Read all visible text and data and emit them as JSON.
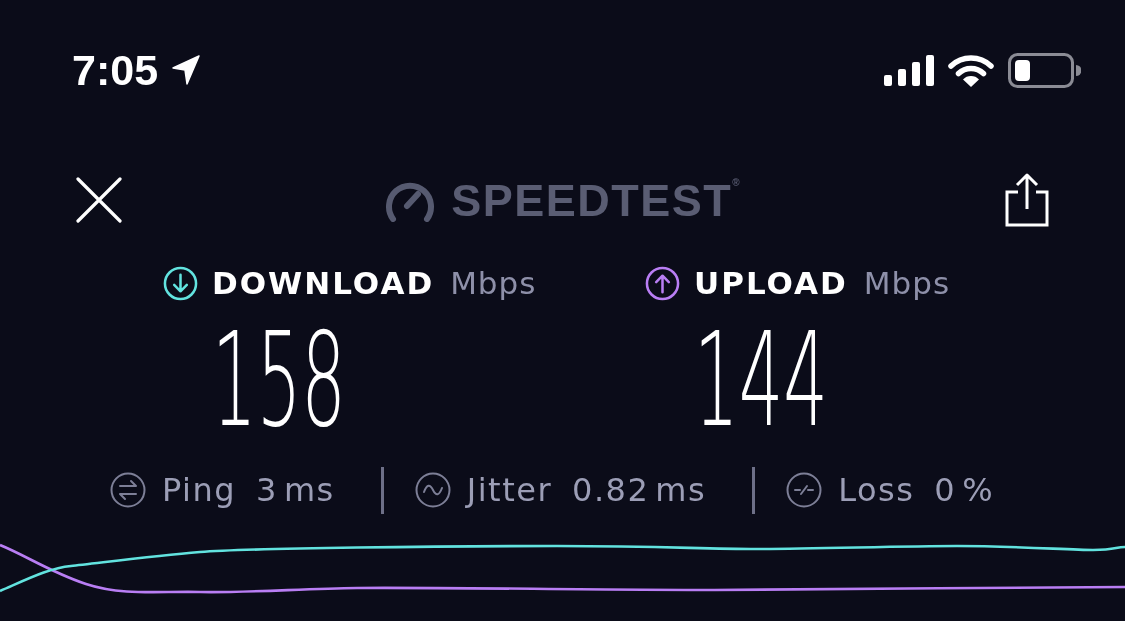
{
  "status_bar": {
    "time": "7:05"
  },
  "header": {
    "logo": "SPEEDTEST$^{®}$"
  },
  "results": [
    {
      "kind": "download",
      "label": "DOWNLOAD",
      "unit": "Mbps",
      "value": "158",
      "color": "#62e3df"
    },
    {
      "kind": "upload",
      "label": "UPLOAD",
      "unit": "Mbps",
      "value": "144",
      "color": "#b97ef4"
    }
  ],
  "metrics": [
    {
      "kind": "ping",
      "label": "Ping",
      "value": "3",
      "unit": "ms"
    },
    {
      "kind": "jitter",
      "label": "Jitter",
      "value": "0.82",
      "unit": "ms"
    },
    {
      "kind": "loss",
      "label": "Loss",
      "value": "0",
      "unit": "%"
    }
  ]
}
